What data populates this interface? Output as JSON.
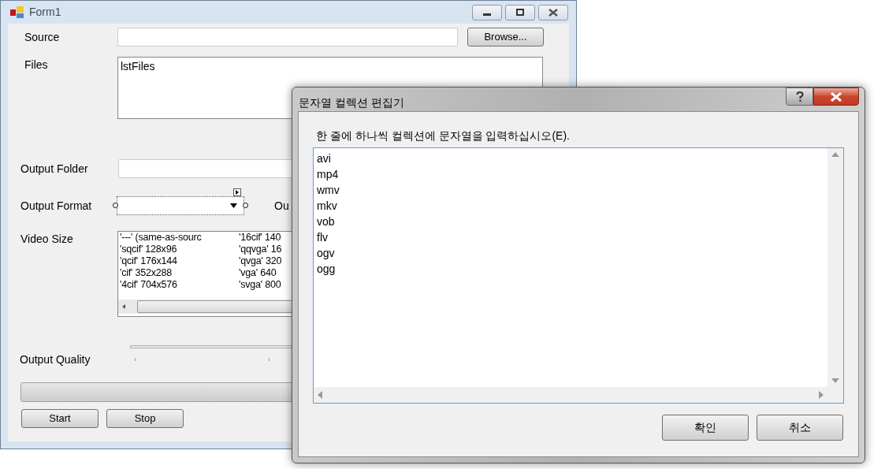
{
  "form_window": {
    "title": "Form1",
    "source_label": "Source",
    "browse_button": "Browse...",
    "files_label": "Files",
    "files_list": [
      "lstFiles"
    ],
    "output_folder_label": "Output Folder",
    "output_format_label": "Output Format",
    "cut_label": "Ou",
    "video_size_label": "Video Size",
    "video_size_columns": [
      [
        "'---' (same-as-sourc",
        "'sqcif' 128x96",
        "'qcif' 176x144",
        "'cif' 352x288",
        "'4cif' 704x576"
      ],
      [
        "'16cif' 140",
        "'qqvga' 16",
        "'qvga' 320",
        "'vga' 640",
        "'svga' 800"
      ]
    ],
    "output_quality_label": "Output Quality",
    "progress": {
      "level": 0
    },
    "buttons": [
      "Start",
      "Stop"
    ]
  },
  "dialog": {
    "title": "문자열 컬렉션 편집기",
    "prompt": "한 줄에 하나씩 컬렉션에 문자열을 입력하십시오(E).",
    "lines": [
      "avi",
      "mp4",
      "wmv",
      "mkv",
      "vob",
      "flv",
      "ogv",
      "ogg"
    ],
    "buttons": [
      "확인",
      "취소"
    ]
  }
}
